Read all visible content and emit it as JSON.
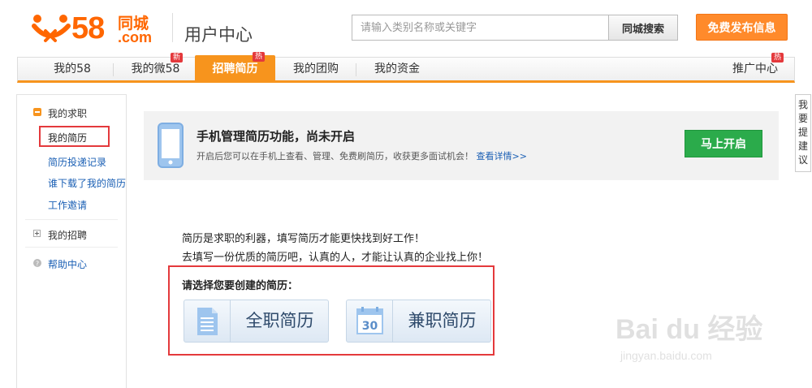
{
  "header": {
    "logo_num": "58",
    "logo_cn": "同城",
    "logo_com": ".com",
    "title": "用户中心",
    "search_placeholder": "请输入类别名称或关键字",
    "search_button": "同城搜索",
    "publish_button": "免费发布信息"
  },
  "nav": {
    "items": [
      {
        "label": "我的58",
        "badge": ""
      },
      {
        "label": "我的微58",
        "badge": "新"
      },
      {
        "label": "招聘简历",
        "badge": "热"
      },
      {
        "label": "我的团购",
        "badge": ""
      },
      {
        "label": "我的资金",
        "badge": ""
      }
    ],
    "right_item": {
      "label": "推广中心",
      "badge": "热"
    },
    "active_index": 2
  },
  "sidebar": {
    "group1": "我的求职",
    "group1_items": [
      "我的简历",
      "简历投递记录",
      "谁下载了我的简历",
      "工作邀请"
    ],
    "group2": "我的招聘",
    "help": "帮助中心"
  },
  "feedback": {
    "chars": [
      "我",
      "要",
      "提",
      "建",
      "议"
    ]
  },
  "banner": {
    "title": "手机管理简历功能，尚未开启",
    "desc": "开启后您可以在手机上查看、管理、免费刷简历，收获更多面试机会！",
    "link": "查看详情>>",
    "button": "马上开启"
  },
  "main": {
    "line1": "简历是求职的利器，填写简历才能更快找到好工作！",
    "line2": "去填写一份优质的简历吧，认真的人，才能让认真的企业找上你！",
    "choose_label": "请选择您要创建的简历：",
    "fulltime": "全职简历",
    "parttime": "兼职简历",
    "calendar_num": "30"
  },
  "watermark": {
    "main": "Bai du 经验",
    "sub": "jingyan.baidu.com"
  },
  "colors": {
    "brand": "#f60",
    "nav_accent": "#f7941d",
    "highlight": "#e4393c",
    "green": "#2bab4b",
    "link": "#1a5fb4"
  }
}
